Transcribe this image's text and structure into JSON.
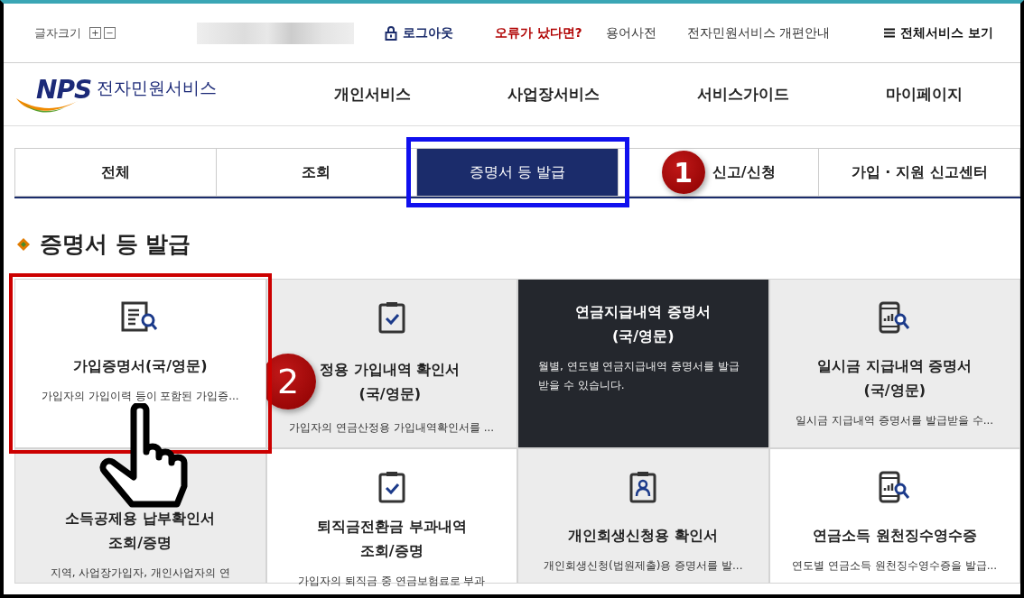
{
  "utility_bar": {
    "font_size_label": "글자크기",
    "font_size_buttons": [
      "+",
      "−"
    ],
    "logout": "로그아웃",
    "error_link": "오류가 났다면?",
    "links": [
      "용어사전",
      "전자민원서비스 개편안내"
    ],
    "all_services": "전체서비스 보기"
  },
  "header": {
    "logo_mark": "NPS",
    "logo_text": "전자민원서비스",
    "menu": [
      "개인서비스",
      "사업장서비스",
      "서비스가이드",
      "마이페이지"
    ]
  },
  "tabs": [
    {
      "label": "전체",
      "selected": false,
      "highlighted": false
    },
    {
      "label": "조회",
      "selected": false,
      "highlighted": false
    },
    {
      "label": "증명서 등 발급",
      "selected": true,
      "highlighted": true
    },
    {
      "label": "신고/신청",
      "selected": false,
      "highlighted": false,
      "badge": "1"
    },
    {
      "label": "가입 · 지원 신고센터",
      "selected": false,
      "highlighted": false
    }
  ],
  "section_title": "증명서 등 발급",
  "cards": [
    {
      "kind": "document",
      "hovered": false,
      "highlighted": true,
      "title": [
        "가입증명서(국/영문)"
      ],
      "desc": "가입자의 가입이력 등이 포함된 가입증..."
    },
    {
      "kind": "clipboard",
      "hovered": false,
      "highlighted": false,
      "badge": "2",
      "title": [
        "정용 가입내역 확인서",
        "(국/영문)"
      ],
      "desc": "가입자의 연금산정용 가입내역확인서를 ..."
    },
    {
      "kind": "none",
      "hovered": true,
      "highlighted": false,
      "title": [
        "연금지급내역 증명서",
        "(국/영문)"
      ],
      "desc": "월별, 연도별 연금지급내역 증명서를 발급 받을 수 있습니다."
    },
    {
      "kind": "phone",
      "hovered": false,
      "highlighted": false,
      "title": [
        "일시금 지급내역 증명서",
        "(국/영문)"
      ],
      "desc": "일시금 지급내역 증명서를 발급받을 수..."
    },
    {
      "kind": "none",
      "hovered": false,
      "highlighted": false,
      "title": [
        "소득공제용 납부확인서",
        "조회/증명"
      ],
      "desc": "지역, 사업장가입자, 개인사업자의 연"
    },
    {
      "kind": "clipboard",
      "hovered": false,
      "highlighted": false,
      "title": [
        "퇴직금전환금 부과내역",
        "조회/증명"
      ],
      "desc": "가입자의 퇴직금 중 연금보험료로 부과"
    },
    {
      "kind": "person",
      "hovered": false,
      "highlighted": false,
      "title": [
        "개인회생신청용 확인서"
      ],
      "desc": "개인회생신청(법원제출)용 증명서를 발..."
    },
    {
      "kind": "phone",
      "hovered": false,
      "highlighted": false,
      "title": [
        "연금소득 원천징수영수증"
      ],
      "desc": "연도별 연금소득 원천징수영수증을 발급..."
    }
  ]
}
